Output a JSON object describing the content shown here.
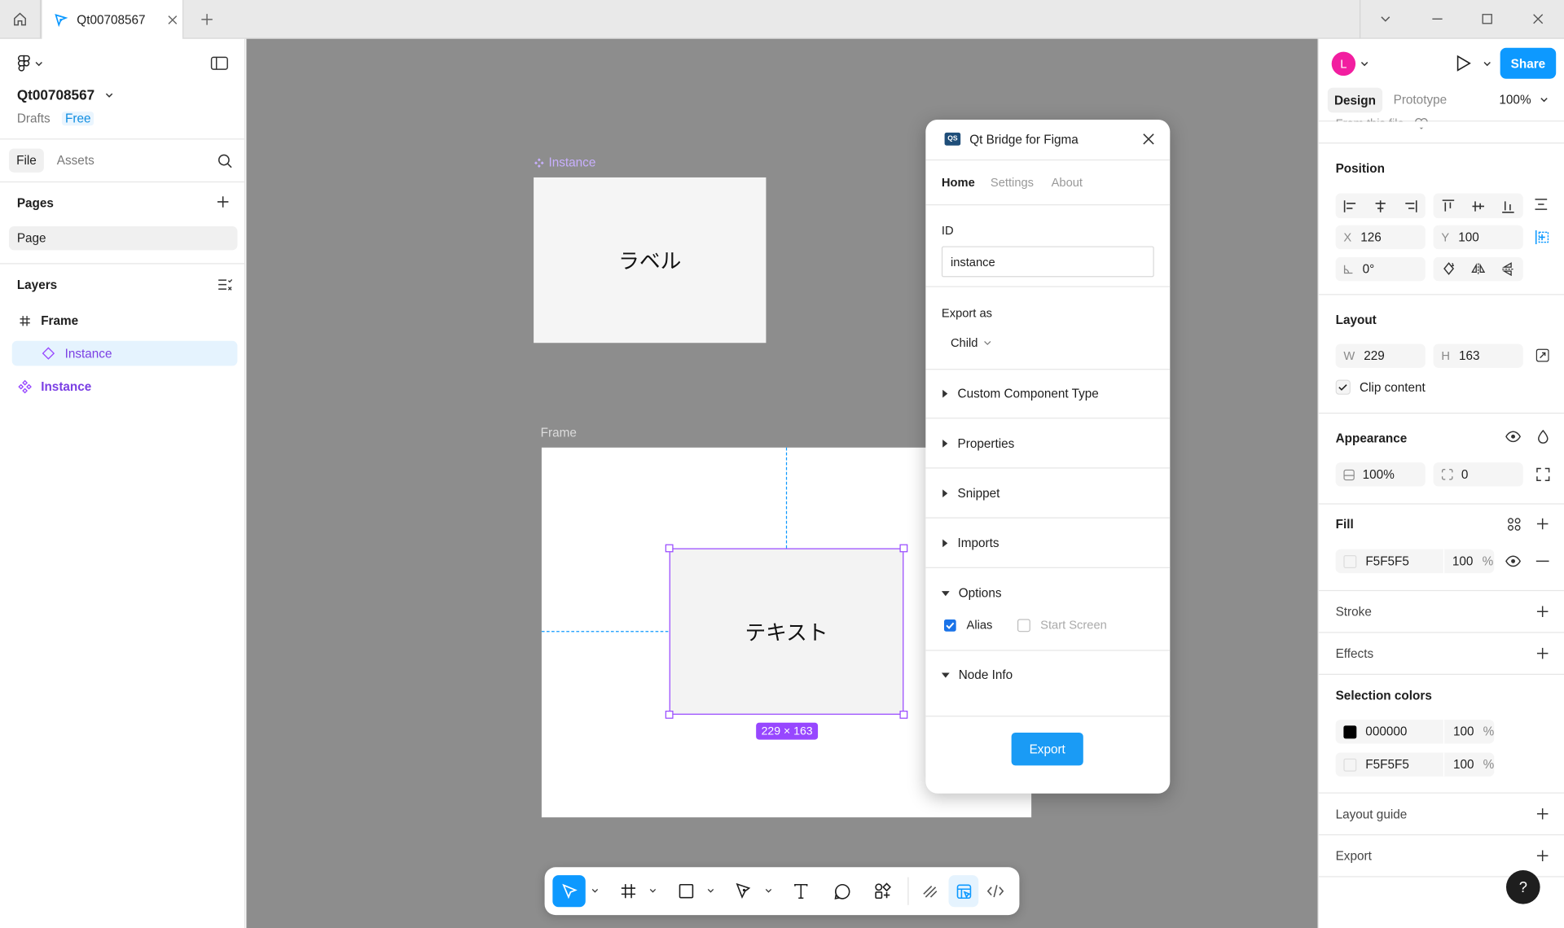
{
  "tab": {
    "title": "Qt00708567"
  },
  "left_panel": {
    "file_name": "Qt00708567",
    "location": "Drafts",
    "plan": "Free",
    "tabs": [
      "File",
      "Assets"
    ],
    "pages_heading": "Pages",
    "pages": [
      "Page"
    ],
    "layers_heading": "Layers",
    "layers": [
      {
        "name": "Frame",
        "type": "frame"
      },
      {
        "name": "Instance",
        "type": "instance",
        "selected": true
      },
      {
        "name": "Instance",
        "type": "component"
      }
    ]
  },
  "canvas": {
    "component_label": "Instance",
    "component_text": "ラベル",
    "frame_label": "Frame",
    "instance_text": "テキスト",
    "size_badge": "229 × 163",
    "selection_color": "#9747ff",
    "canvas_color": "#8d8d8d"
  },
  "plugin": {
    "title": "Qt Bridge for Figma",
    "logo_text": "QS",
    "tabs": [
      "Home",
      "Settings",
      "About"
    ],
    "id_label": "ID",
    "id_value": "instance",
    "export_as_label": "Export as",
    "export_as_value": "Child",
    "sections": [
      "Custom Component Type",
      "Properties",
      "Snippet",
      "Imports"
    ],
    "options_label": "Options",
    "alias_label": "Alias",
    "alias_checked": true,
    "start_screen_label": "Start Screen",
    "start_screen_checked": false,
    "node_info_label": "Node Info",
    "export_button": "Export"
  },
  "right_panel": {
    "avatar_letter": "L",
    "share_label": "Share",
    "tabs": [
      "Design",
      "Prototype"
    ],
    "zoom": "100%",
    "from_file": "From this file",
    "position": {
      "heading": "Position",
      "x_label": "X",
      "x": "126",
      "y_label": "Y",
      "y": "100",
      "rotation": "0°"
    },
    "layout": {
      "heading": "Layout",
      "w_label": "W",
      "w": "229",
      "h_label": "H",
      "h": "163",
      "clip_label": "Clip content",
      "clip_checked": true
    },
    "appearance": {
      "heading": "Appearance",
      "opacity": "100%",
      "radius": "0"
    },
    "fill": {
      "heading": "Fill",
      "hex": "F5F5F5",
      "opacity": "100",
      "unit": "%"
    },
    "stroke_heading": "Stroke",
    "effects_heading": "Effects",
    "selection_colors": {
      "heading": "Selection colors",
      "items": [
        {
          "hex": "000000",
          "opacity": "100",
          "unit": "%",
          "swatch": "#000000"
        },
        {
          "hex": "F5F5F5",
          "opacity": "100",
          "unit": "%",
          "swatch": "#f5f5f5"
        }
      ]
    },
    "layout_guide_heading": "Layout guide",
    "export_heading": "Export",
    "help": "?"
  },
  "colors": {
    "accent": "#0d99ff",
    "purple": "#9747ff",
    "brand_pink": "#f24e9e"
  }
}
